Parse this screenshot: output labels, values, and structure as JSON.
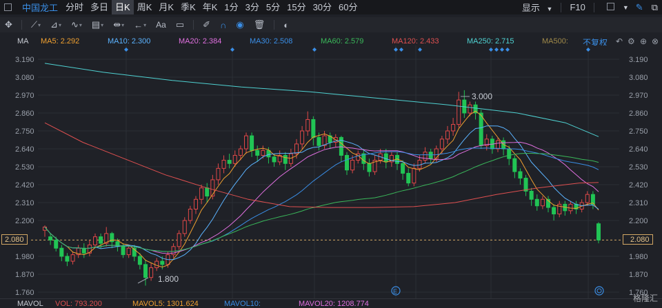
{
  "topbar": {
    "stock_name": "中国龙工",
    "periods": [
      "分时",
      "多日",
      "日K",
      "周K",
      "月K",
      "季K",
      "年K",
      "1分",
      "3分",
      "5分",
      "15分",
      "30分",
      "60分"
    ],
    "active_period": "日K",
    "display_label": "显示",
    "f10_label": "F10"
  },
  "ma_legend": {
    "ma5": "MA5: 2.292",
    "ma10": "MA10: 2.300",
    "ma20": "MA20: 2.384",
    "ma30": "MA30: 2.508",
    "ma60": "MA60: 2.579",
    "ma120": "MA120: 2.433",
    "ma250": "MA250: 2.715",
    "ma500": "MA500:",
    "title": "MA",
    "adjust_label": "不复权"
  },
  "colors": {
    "up": "#e04848",
    "down": "#21c455",
    "ma5": "#f0a030",
    "ma10": "#5bb3ff",
    "ma20": "#e070e0",
    "ma30": "#3a8ee6",
    "ma60": "#3ab85a",
    "ma120": "#e05050",
    "ma250": "#4fd2d2",
    "ma500": "#a08a4a"
  },
  "chart_data": {
    "type": "candlestick",
    "y_ticks": [
      "3.190",
      "3.080",
      "2.970",
      "2.860",
      "2.750",
      "2.640",
      "2.530",
      "2.420",
      "2.310",
      "2.200",
      "1.980",
      "1.870",
      "1.760"
    ],
    "ylim": [
      1.76,
      3.19
    ],
    "current_price": "2.080",
    "high_annotation": "3.000",
    "low_annotation": "1.800",
    "candles": [
      [
        2.14,
        2.16,
        2.1,
        2.17
      ],
      [
        2.1,
        2.08,
        2.05,
        2.12
      ],
      [
        2.08,
        2.03,
        2.01,
        2.1
      ],
      [
        2.03,
        1.98,
        1.95,
        2.05
      ],
      [
        1.98,
        1.95,
        1.92,
        2.0
      ],
      [
        1.95,
        1.99,
        1.93,
        2.01
      ],
      [
        1.99,
        2.03,
        1.97,
        2.05
      ],
      [
        2.03,
        2.0,
        1.97,
        2.06
      ],
      [
        2.0,
        2.05,
        1.98,
        2.08
      ],
      [
        2.05,
        2.1,
        2.03,
        2.12
      ],
      [
        2.1,
        2.06,
        2.03,
        2.12
      ],
      [
        2.06,
        2.12,
        2.04,
        2.16
      ],
      [
        2.12,
        2.07,
        2.03,
        2.13
      ],
      [
        2.07,
        2.04,
        2.01,
        2.09
      ],
      [
        2.04,
        1.99,
        1.97,
        2.06
      ],
      [
        1.99,
        2.03,
        1.97,
        2.05
      ],
      [
        2.03,
        1.98,
        1.95,
        2.05
      ],
      [
        1.98,
        1.93,
        1.9,
        2.0
      ],
      [
        1.93,
        1.85,
        1.8,
        1.96
      ],
      [
        1.85,
        1.91,
        1.83,
        1.94
      ],
      [
        1.91,
        1.95,
        1.89,
        1.97
      ],
      [
        1.95,
        1.93,
        1.9,
        1.98
      ],
      [
        1.93,
        1.99,
        1.91,
        2.01
      ],
      [
        1.99,
        2.04,
        1.97,
        2.06
      ],
      [
        2.04,
        2.12,
        2.02,
        2.14
      ],
      [
        2.12,
        2.2,
        2.1,
        2.22
      ],
      [
        2.2,
        2.27,
        2.18,
        2.29
      ],
      [
        2.27,
        2.33,
        2.24,
        2.35
      ],
      [
        2.33,
        2.4,
        2.3,
        2.42
      ],
      [
        2.4,
        2.35,
        2.31,
        2.43
      ],
      [
        2.35,
        2.45,
        2.33,
        2.48
      ],
      [
        2.45,
        2.52,
        2.42,
        2.55
      ],
      [
        2.52,
        2.57,
        2.49,
        2.6
      ],
      [
        2.57,
        2.55,
        2.52,
        2.61
      ],
      [
        2.55,
        2.6,
        2.53,
        2.63
      ],
      [
        2.6,
        2.64,
        2.57,
        2.66
      ],
      [
        2.64,
        2.72,
        2.61,
        2.74
      ],
      [
        2.72,
        2.63,
        2.59,
        2.74
      ],
      [
        2.63,
        2.6,
        2.56,
        2.66
      ],
      [
        2.6,
        2.63,
        2.58,
        2.66
      ],
      [
        2.63,
        2.59,
        2.55,
        2.65
      ],
      [
        2.59,
        2.56,
        2.53,
        2.61
      ],
      [
        2.56,
        2.6,
        2.54,
        2.63
      ],
      [
        2.6,
        2.55,
        2.51,
        2.62
      ],
      [
        2.55,
        2.61,
        2.53,
        2.64
      ],
      [
        2.61,
        2.67,
        2.58,
        2.7
      ],
      [
        2.67,
        2.75,
        2.64,
        2.78
      ],
      [
        2.75,
        2.82,
        2.72,
        2.87
      ],
      [
        2.82,
        2.71,
        2.66,
        2.84
      ],
      [
        2.71,
        2.66,
        2.63,
        2.74
      ],
      [
        2.66,
        2.72,
        2.64,
        2.75
      ],
      [
        2.72,
        2.68,
        2.64,
        2.74
      ],
      [
        2.68,
        2.71,
        2.65,
        2.73
      ],
      [
        2.71,
        2.6,
        2.56,
        2.72
      ],
      [
        2.6,
        2.51,
        2.48,
        2.62
      ],
      [
        2.51,
        2.57,
        2.49,
        2.6
      ],
      [
        2.57,
        2.61,
        2.55,
        2.63
      ],
      [
        2.61,
        2.55,
        2.51,
        2.64
      ],
      [
        2.55,
        2.5,
        2.47,
        2.58
      ],
      [
        2.5,
        2.57,
        2.48,
        2.6
      ],
      [
        2.57,
        2.61,
        2.55,
        2.64
      ],
      [
        2.61,
        2.56,
        2.52,
        2.64
      ],
      [
        2.56,
        2.6,
        2.53,
        2.62
      ],
      [
        2.6,
        2.55,
        2.51,
        2.62
      ],
      [
        2.55,
        2.49,
        2.45,
        2.57
      ],
      [
        2.49,
        2.43,
        2.41,
        2.52
      ],
      [
        2.43,
        2.52,
        2.41,
        2.55
      ],
      [
        2.52,
        2.57,
        2.5,
        2.6
      ],
      [
        2.57,
        2.62,
        2.55,
        2.65
      ],
      [
        2.62,
        2.58,
        2.55,
        2.64
      ],
      [
        2.58,
        2.64,
        2.56,
        2.66
      ],
      [
        2.64,
        2.7,
        2.61,
        2.72
      ],
      [
        2.7,
        2.75,
        2.67,
        2.78
      ],
      [
        2.75,
        2.79,
        2.72,
        2.83
      ],
      [
        2.79,
        2.94,
        2.77,
        2.99
      ],
      [
        2.94,
        2.86,
        2.83,
        3.0
      ],
      [
        2.86,
        2.91,
        2.84,
        2.93
      ],
      [
        2.91,
        2.86,
        2.82,
        2.93
      ],
      [
        2.86,
        2.66,
        2.64,
        2.88
      ],
      [
        2.66,
        2.7,
        2.63,
        2.73
      ],
      [
        2.7,
        2.64,
        2.61,
        2.72
      ],
      [
        2.64,
        2.69,
        2.62,
        2.71
      ],
      [
        2.69,
        2.64,
        2.6,
        2.71
      ],
      [
        2.64,
        2.58,
        2.54,
        2.66
      ],
      [
        2.58,
        2.5,
        2.46,
        2.6
      ],
      [
        2.5,
        2.46,
        2.42,
        2.52
      ],
      [
        2.46,
        2.38,
        2.35,
        2.48
      ],
      [
        2.38,
        2.33,
        2.29,
        2.4
      ],
      [
        2.33,
        2.29,
        2.26,
        2.36
      ],
      [
        2.29,
        2.33,
        2.27,
        2.35
      ],
      [
        2.33,
        2.28,
        2.25,
        2.35
      ],
      [
        2.28,
        2.24,
        2.2,
        2.3
      ],
      [
        2.24,
        2.3,
        2.22,
        2.32
      ],
      [
        2.3,
        2.26,
        2.23,
        2.32
      ],
      [
        2.26,
        2.3,
        2.24,
        2.32
      ],
      [
        2.3,
        2.27,
        2.24,
        2.32
      ],
      [
        2.27,
        2.31,
        2.25,
        2.33
      ],
      [
        2.31,
        2.36,
        2.29,
        2.38
      ],
      [
        2.36,
        2.3,
        2.27,
        2.38
      ],
      [
        2.18,
        2.08,
        2.06,
        2.19
      ]
    ]
  },
  "bottom_bar": {
    "title": "MAVOL",
    "vol": "VOL: 793.200",
    "mavol5": "MAVOL5: 1301.624",
    "mavol10": "MAVOL10:",
    "mavol20": "MAVOL20: 1208.774"
  },
  "watermark": "格隆汇"
}
